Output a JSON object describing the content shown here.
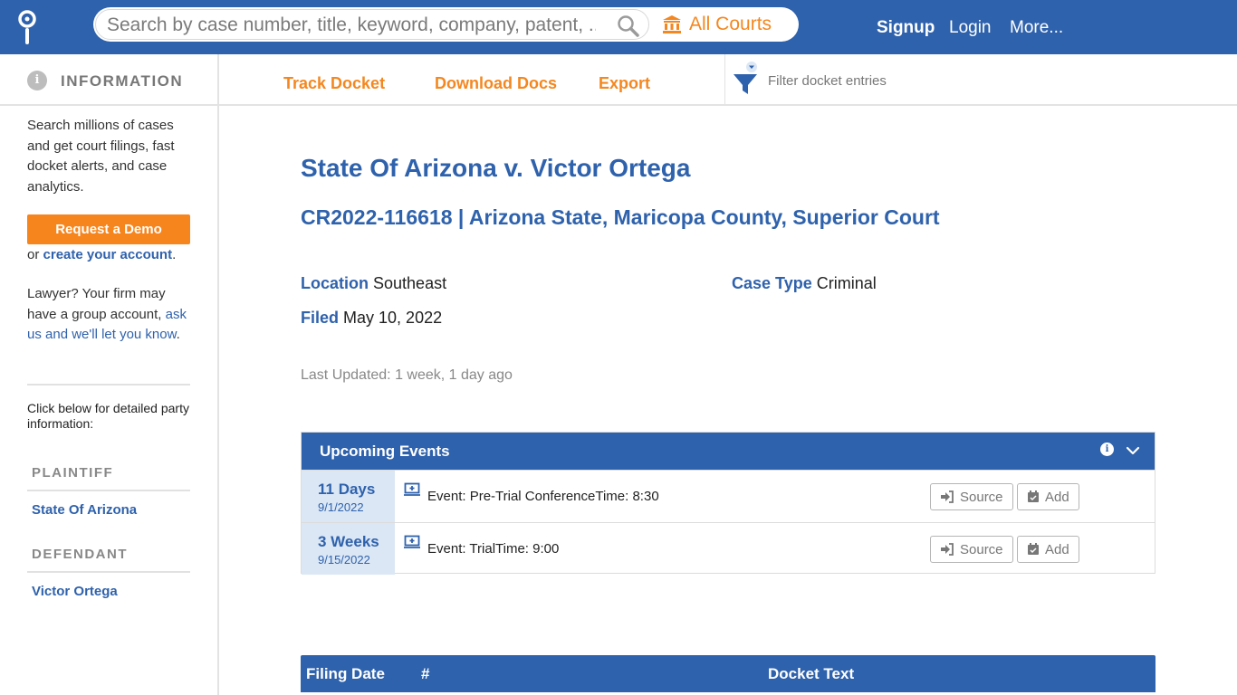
{
  "header": {
    "search_placeholder": "Search by case number, title, keyword, company, patent, ...",
    "courts_label": "All Courts",
    "nav": {
      "signup": "Signup",
      "login": "Login",
      "more": "More..."
    }
  },
  "sidebar": {
    "heading": "INFORMATION",
    "intro": "Search millions of cases and get court filings, fast docket alerts, and case analytics.",
    "demo_button": "Request a Demo",
    "or_text": "or",
    "create_account": "create your account",
    "period": ".",
    "lawyer_text": "Lawyer? Your firm may have a group account,",
    "lawyer_link": "ask us and we'll let you know",
    "party_intro": "Click below for detailed party information:",
    "plaintiff_heading": "PLAINTIFF",
    "plaintiff": "State Of Arizona",
    "defendant_heading": "DEFENDANT",
    "defendant": "Victor Ortega"
  },
  "toolbar": {
    "track": "Track Docket",
    "download": "Download Docs",
    "export": "Export",
    "filter_placeholder": "Filter docket entries"
  },
  "case": {
    "title": "State Of Arizona v. Victor Ortega",
    "subtitle": "CR2022-116618 | Arizona State, Maricopa County, Superior Court",
    "location_label": "Location",
    "location": "Southeast",
    "case_type_label": "Case Type",
    "case_type": "Criminal",
    "filed_label": "Filed",
    "filed": "May 10, 2022",
    "last_updated": "Last Updated: 1 week, 1 day ago"
  },
  "events": {
    "title": "Upcoming Events",
    "rows": [
      {
        "relative": "11 Days",
        "date": "9/1/2022",
        "text": "Event: Pre-Trial ConferenceTime: 8:30",
        "source": "Source",
        "add": "Add"
      },
      {
        "relative": "3 Weeks",
        "date": "9/15/2022",
        "text": "Event: TrialTime: 9:00",
        "source": "Source",
        "add": "Add"
      }
    ]
  },
  "docket": {
    "col_filing_date": "Filing Date",
    "col_number": "#",
    "col_text": "Docket Text"
  },
  "colors": {
    "brand_blue": "#2f62ac",
    "accent_orange": "#f4871f"
  }
}
